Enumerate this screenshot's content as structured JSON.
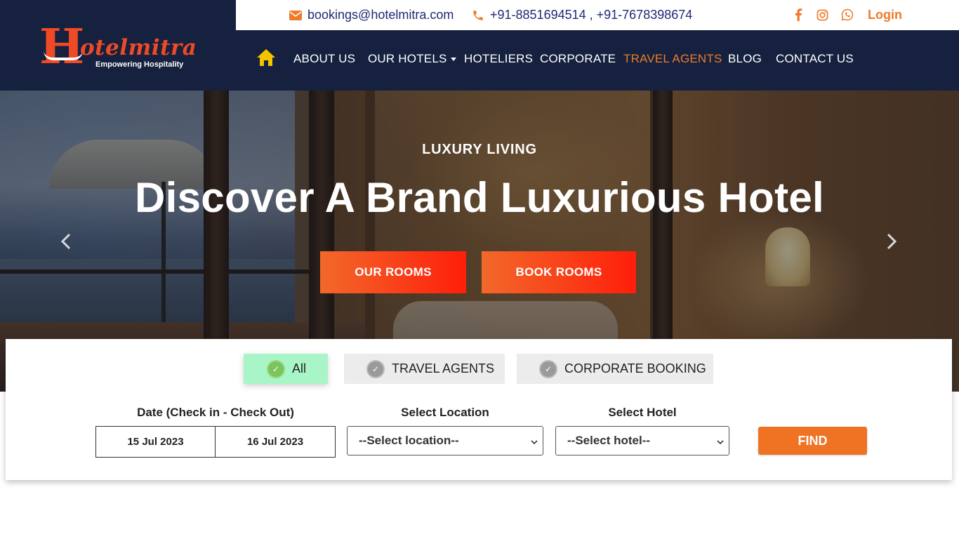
{
  "brand": {
    "logo_letter": "H",
    "logo_word": "otelmitra",
    "tagline": "Empowering Hospitality"
  },
  "topbar": {
    "email": "bookings@hotelmitra.com",
    "phones": "+91-8851694514 , +91-7678398674",
    "login": "Login",
    "social": [
      "facebook-icon",
      "instagram-icon",
      "whatsapp-icon"
    ]
  },
  "nav": {
    "items": [
      {
        "label": "ABOUT US"
      },
      {
        "label": "OUR HOTELS"
      },
      {
        "label": "HOTELIERS"
      },
      {
        "label": "CORPORATE"
      },
      {
        "label": "TRAVEL AGENTS"
      },
      {
        "label": "BLOG"
      },
      {
        "label": "CONTACT US"
      }
    ],
    "active": "TRAVEL AGENTS"
  },
  "hero": {
    "kicker": "LUXURY LIVING",
    "title": "Discover A Brand Luxurious Hotel",
    "buttons": [
      "OUR ROOMS",
      "BOOK ROOMS"
    ]
  },
  "search": {
    "tabs": [
      {
        "label": "All",
        "selected": true
      },
      {
        "label": "TRAVEL AGENTS",
        "selected": false
      },
      {
        "label": "CORPORATE BOOKING",
        "selected": false
      }
    ],
    "date_label": "Date (Check in - Check Out)",
    "check_in": "15 Jul 2023",
    "check_out": "16 Jul 2023",
    "location_label": "Select Location",
    "location_value": "--Select location--",
    "hotel_label": "Select Hotel",
    "hotel_value": "--Select hotel--",
    "find": "FIND"
  },
  "colors": {
    "navy": "#15213f",
    "accent_orange": "#ee7a2a",
    "brand_red": "#ee4a25",
    "tab_active_bg": "#a8f5c7"
  }
}
